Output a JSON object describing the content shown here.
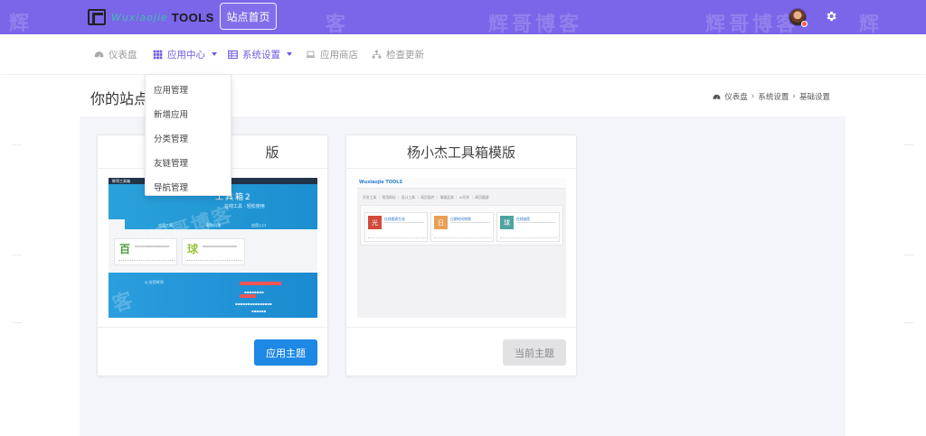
{
  "header": {
    "logo_script": "Wuxiaojie",
    "logo_text": "TOOLS",
    "site_home_label": "站点首页",
    "watermark": "辉哥博客"
  },
  "nav": {
    "items": [
      {
        "label": "仪表盘",
        "icon": "dashboard-icon",
        "active": false
      },
      {
        "label": "应用中心",
        "icon": "grid-icon",
        "active": true,
        "has_caret": true
      },
      {
        "label": "系统设置",
        "icon": "table-icon",
        "active": false,
        "has_caret": true
      },
      {
        "label": "应用商店",
        "icon": "laptop-icon",
        "active": false
      },
      {
        "label": "检查更新",
        "icon": "sitemap-icon",
        "active": false
      }
    ]
  },
  "page": {
    "title": "你的站点",
    "breadcrumb": [
      "仪表盘",
      "系统设置",
      "基础设置"
    ]
  },
  "dropdown": {
    "items": [
      "应用管理",
      "新增应用",
      "分类管理",
      "友链管理",
      "导航管理"
    ]
  },
  "themes": [
    {
      "title_suffix": "版",
      "button_label": "应用主题",
      "button_state": "primary",
      "preview": {
        "header_big": "工具箱2",
        "header_small": "在线工具 · 轻松使用",
        "header_bar": "辉哥工具箱",
        "links": [
          "应用工具",
          "帮助问答",
          "应用入口"
        ],
        "tiles": [
          {
            "char": "百",
            "color": "#4f9e3b"
          },
          {
            "char": "球",
            "color": "#a0c43b"
          }
        ],
        "footer_brand": "◎ 应用时间"
      }
    },
    {
      "title": "杨小杰工具箱模版",
      "button_label": "当前主题",
      "button_state": "disabled",
      "preview": {
        "brand": "Wuxiaojie TOOLS",
        "menu": "开发工具 ｜ 常用网站 ｜ 设计工具 ｜ 网页插件 ｜ 情报监测 ｜ AI写作 ｜ 网页截屏",
        "tiles": [
          {
            "char": "光",
            "name": "在线图表生成",
            "color": "#d24a3b"
          },
          {
            "char": "日",
            "name": "日期时间转换",
            "color": "#e9a055"
          },
          {
            "char": "球",
            "name": "在线抽签",
            "color": "#4fa3a0"
          }
        ]
      }
    }
  ],
  "colors": {
    "brand": "#7b65e9",
    "primary_button": "#1e88e5",
    "content_bg": "#f4f5fa"
  }
}
